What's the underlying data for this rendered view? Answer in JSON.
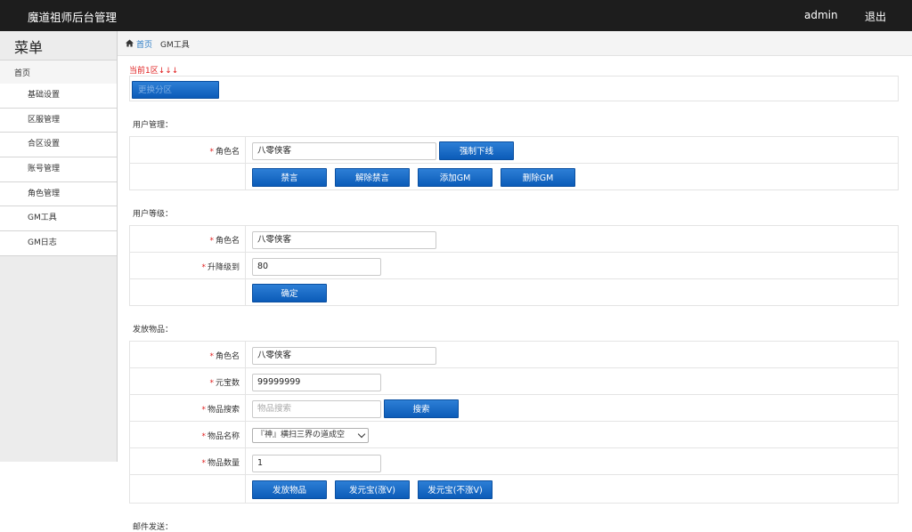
{
  "header": {
    "title": "魔道祖师后台管理",
    "user": "admin",
    "logout": "退出"
  },
  "sidebar": {
    "menu_title": "菜单",
    "home": "首页",
    "items": [
      {
        "label": "基础设置"
      },
      {
        "label": "区服管理"
      },
      {
        "label": "合区设置"
      },
      {
        "label": "账号管理"
      },
      {
        "label": "角色管理"
      },
      {
        "label": "GM工具"
      },
      {
        "label": "GM日志"
      }
    ]
  },
  "breadcrumb": {
    "home": "首页",
    "current": "GM工具"
  },
  "region": {
    "current": "当前1区↓↓↓",
    "change_button": "更换分区"
  },
  "user_mgmt": {
    "title": "用户管理：",
    "role_label": "角色名",
    "role_value": "八零侠客",
    "force_offline": "强制下线",
    "buttons": [
      "禁言",
      "解除禁言",
      "添加GM",
      "删除GM"
    ]
  },
  "user_level": {
    "title": "用户等级：",
    "role_label": "角色名",
    "role_value": "八零侠客",
    "level_label": "升降级到",
    "level_value": "80",
    "confirm": "确定"
  },
  "items": {
    "title": "发放物品：",
    "role_label": "角色名",
    "role_value": "八零侠客",
    "gold_label": "元宝数",
    "gold_value": "99999999",
    "search_label": "物品搜索",
    "search_placeholder": "物品搜索",
    "search_button": "搜索",
    "name_label": "物品名称",
    "name_selected": "『神』横扫三界の道成空",
    "qty_label": "物品数量",
    "qty_value": "1",
    "buttons": [
      "发放物品",
      "发元宝(涨V)",
      "发元宝(不涨V)"
    ]
  },
  "mail": {
    "title": "邮件发送："
  },
  "colors": {
    "header_bg": "#1d1d1d",
    "button": "#0b5bb8",
    "required": "#e02020",
    "link": "#2a7bc6"
  }
}
